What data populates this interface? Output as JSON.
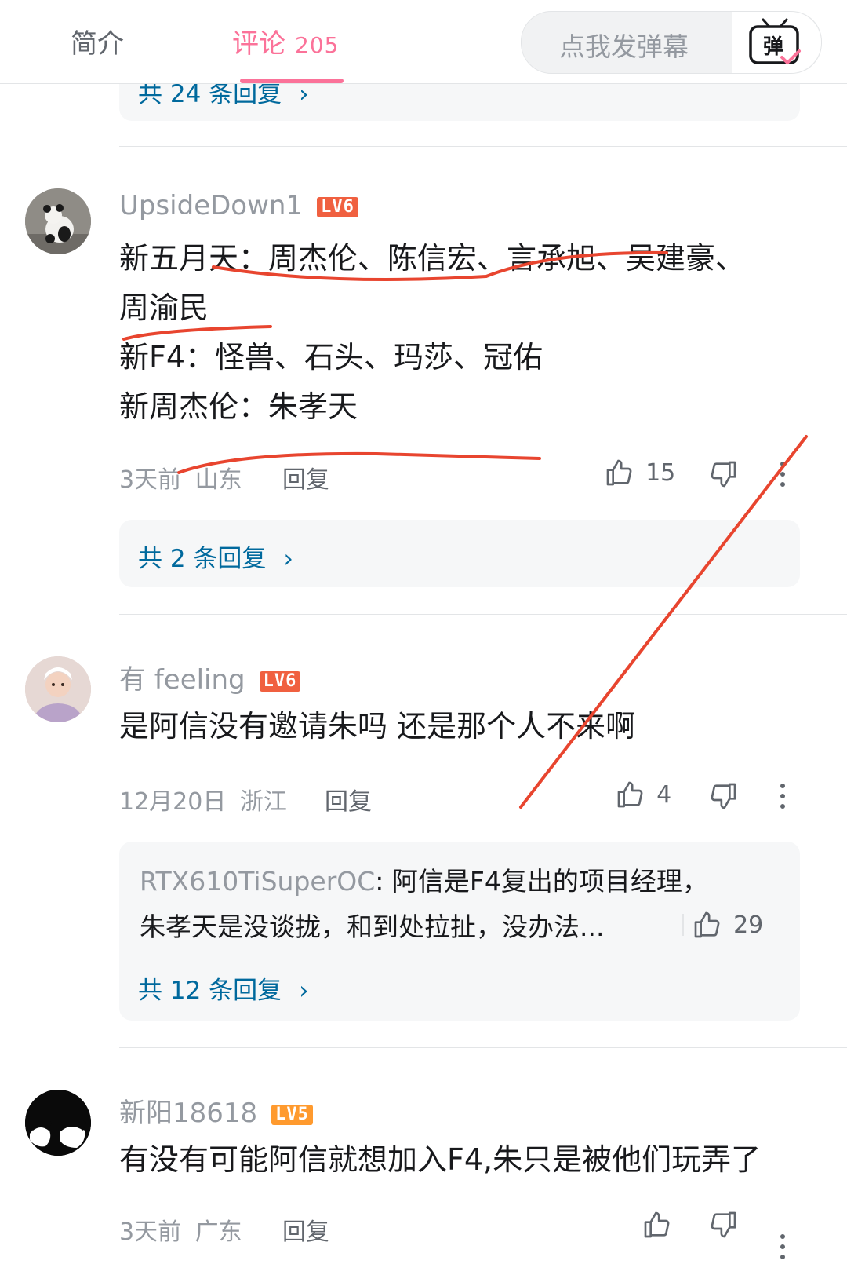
{
  "tabs": {
    "intro_label": "简介",
    "comments_label": "评论",
    "comments_count": "205",
    "danmaku_placeholder": "点我发弹幕",
    "danmaku_icon_label": "弹"
  },
  "top_reply_link": "共 24 条回复",
  "comments": [
    {
      "username": "UpsideDown1",
      "level": "LV6",
      "lines": [
        "新五月天：周杰伦、陈信宏、言承旭、吴建豪、",
        "周渝民",
        "新F4：怪兽、石头、玛莎、冠佑",
        "新周杰伦：朱孝天"
      ],
      "time": "3天前",
      "location": "山东",
      "reply_label": "回复",
      "likes": "15",
      "reply_link": "共 2 条回复"
    },
    {
      "username": "有 feeling",
      "level": "LV6",
      "text": "是阿信没有邀请朱吗 还是那个人不来啊",
      "time": "12月20日",
      "location": "浙江",
      "reply_label": "回复",
      "likes": "4",
      "sub_reply": {
        "username": "RTX610TiSuperOC",
        "line1": "阿信是F4复出的项目经理，",
        "line2": "朱孝天是没谈拢，和到处拉扯，没办法...",
        "likes": "29"
      },
      "reply_link": "共 12 条回复"
    },
    {
      "username": "新阳18618",
      "level": "LV5",
      "text": "有没有可能阿信就想加入F4,朱只是被他们玩弄了",
      "time": "3天前",
      "location": "广东",
      "reply_label": "回复"
    }
  ],
  "colors": {
    "accent_pink": "#fb7299",
    "lv6": "#f06040",
    "lv5": "#ff9a2e",
    "link_blue": "#00699d",
    "annotation_red": "#e8452f"
  }
}
